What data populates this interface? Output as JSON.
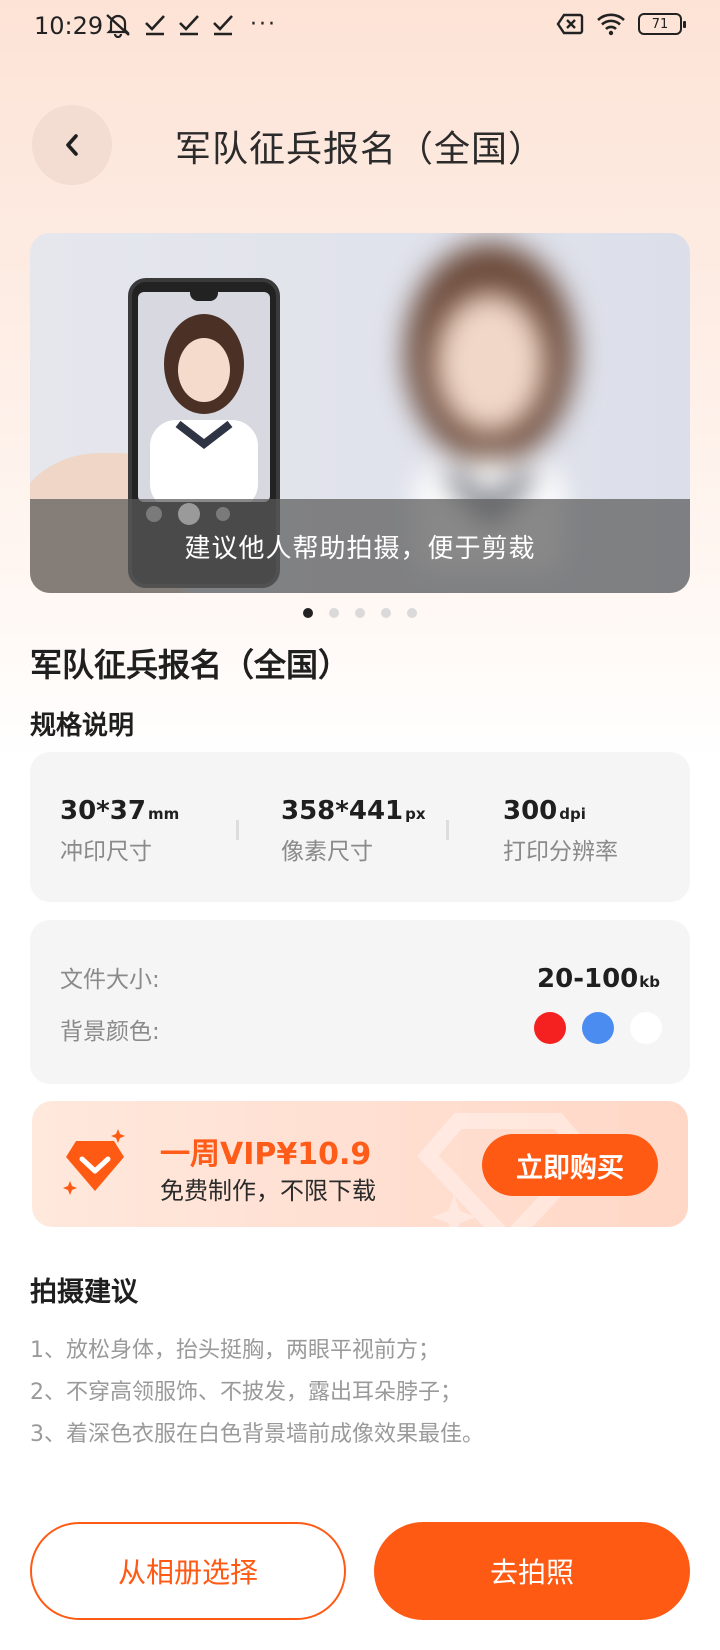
{
  "status_bar": {
    "time": "10:29",
    "icons_left": [
      "mute-bell-icon",
      "check-icon",
      "check-icon",
      "check-icon"
    ],
    "more": "···",
    "battery": "71",
    "icons_right": [
      "sim-off-icon",
      "wifi-icon",
      "battery-icon"
    ]
  },
  "header": {
    "back_icon": "chevron-left-icon",
    "title": "军队征兵报名（全国）"
  },
  "banner": {
    "caption": "建议他人帮助拍摄，便于剪裁",
    "slide_count": 5,
    "active_slide": 1
  },
  "page": {
    "title": "军队征兵报名（全国）",
    "spec_section_title": "规格说明"
  },
  "specs": [
    {
      "value": "30*37",
      "unit": "mm",
      "label": "冲印尺寸"
    },
    {
      "value": "358*441",
      "unit": "px",
      "label": "像素尺寸"
    },
    {
      "value": "300",
      "unit": "dpi",
      "label": "打印分辨率"
    }
  ],
  "file_info": {
    "size_label": "文件大小:",
    "size_value": "20-100",
    "size_unit": "kb",
    "bg_label": "背景颜色:",
    "bg_colors": [
      "#f52020",
      "#4a8cf0",
      "#ffffff"
    ]
  },
  "vip": {
    "title": "一周VIP¥10.9",
    "subtitle": "免费制作，不限下载",
    "buy_label": "立即购买",
    "accent": "#ff5a14"
  },
  "tips": {
    "title": "拍摄建议",
    "items": [
      "1、放松身体，抬头挺胸，两眼平视前方；",
      "2、不穿高领服饰、不披发，露出耳朵脖子；",
      "3、着深色衣服在白色背景墙前成像效果最佳。"
    ]
  },
  "actions": {
    "album_label": "从相册选择",
    "shoot_label": "去拍照"
  }
}
